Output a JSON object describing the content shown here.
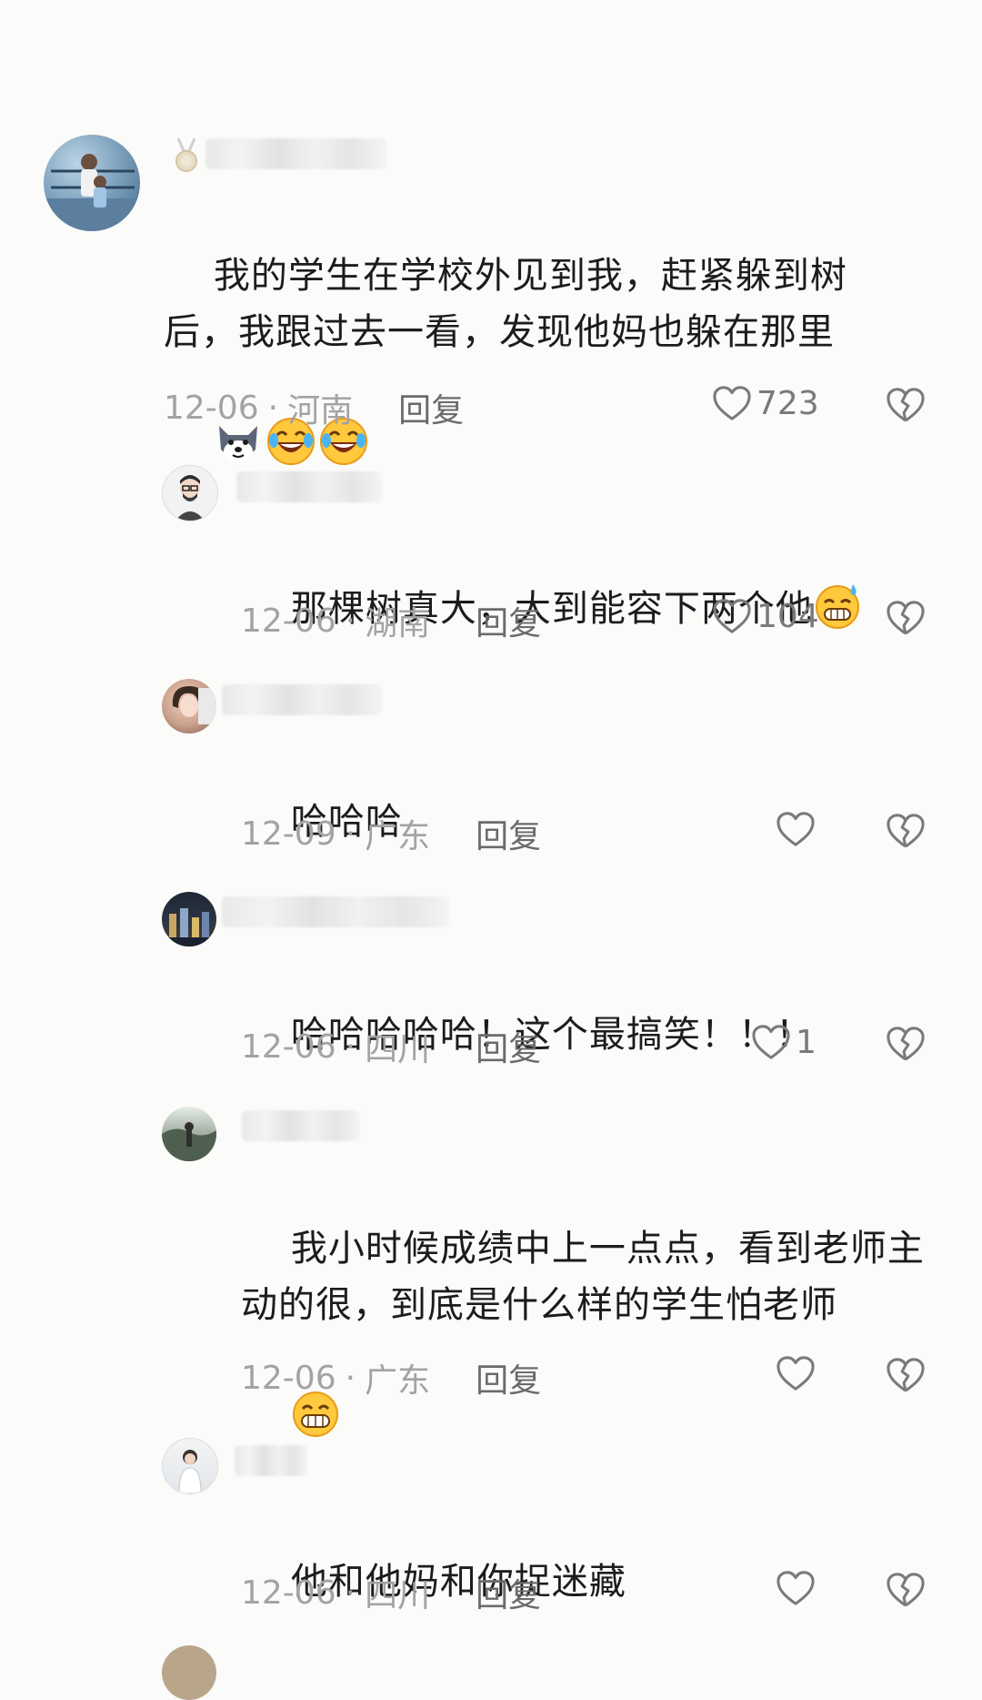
{
  "top_partial_text": "",
  "comments": [
    {
      "content": "我的学生在学校外见到我，赶紧躲到树\n后，我跟过去一看，发现他妈也躲在那里",
      "date": "12-06",
      "location": "河南",
      "reply_label": "回复",
      "likes": "723",
      "emojis": [
        "dog-face-emoji",
        "laughing-tears-emoji",
        "laughing-tears-emoji"
      ]
    },
    {
      "content": "那棵树真大，大到能容下两个他",
      "date": "12-06",
      "location": "湖南",
      "reply_label": "回复",
      "likes": "104",
      "emojis": [
        "grin-sweat-emoji"
      ]
    },
    {
      "content": "哈哈哈",
      "date": "12-09",
      "location": "广东",
      "reply_label": "回复",
      "likes": ""
    },
    {
      "content": "哈哈哈哈哈！这个最搞笑！！！",
      "date": "12-06",
      "location": "四川",
      "reply_label": "回复",
      "likes": "1"
    },
    {
      "content": "我小时候成绩中上一点点，看到老师主\n动的很，到底是什么样的学生怕老师",
      "date": "12-06",
      "location": "广东",
      "reply_label": "回复",
      "likes": "",
      "emojis": [
        "grin-emoji"
      ]
    },
    {
      "content": "他和他妈和你捉迷藏",
      "date": "12-06",
      "location": "四川",
      "reply_label": "回复",
      "likes": ""
    }
  ],
  "separator": "·",
  "colors": {
    "background": "#fbfbf9",
    "text": "#1c1c1c",
    "meta": "#a3a3a3",
    "icon": "#7a7a7a"
  }
}
